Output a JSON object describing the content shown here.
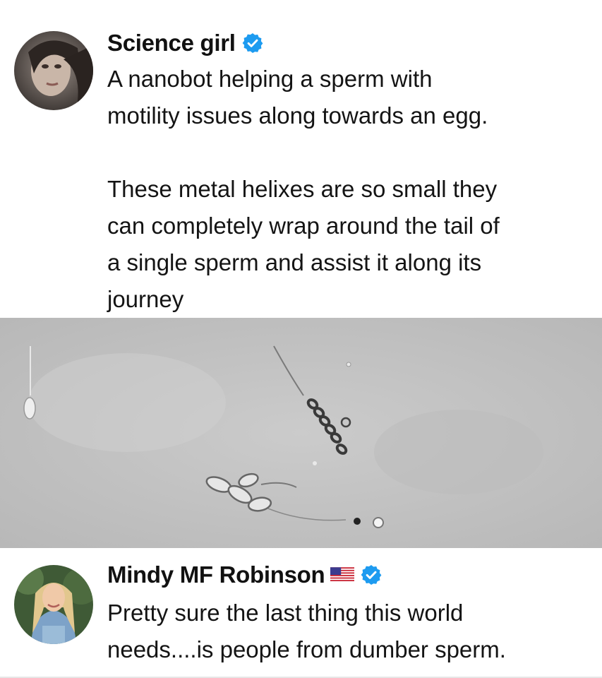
{
  "post1": {
    "author": "Science girl",
    "verified": true,
    "text": "A nanobot helping a sperm with\nmotility issues along towards an egg.\n\nThese metal helixes are so small they\ncan completely wrap around the tail of\na single sperm and assist it along its\njourney",
    "avatar_icon": "avatar-photo-icon",
    "media": {
      "type": "microscope-video-still"
    }
  },
  "post2": {
    "author": "Mindy MF Robinson",
    "flag_icon": "us-flag-icon",
    "verified": true,
    "text": "Pretty sure the last thing this world\nneeds....is people from dumber sperm.",
    "avatar_icon": "avatar-photo-icon"
  },
  "colors": {
    "verified_blue": "#1d9bf0",
    "text": "#141414",
    "media_bg": "#c6c6c6"
  }
}
